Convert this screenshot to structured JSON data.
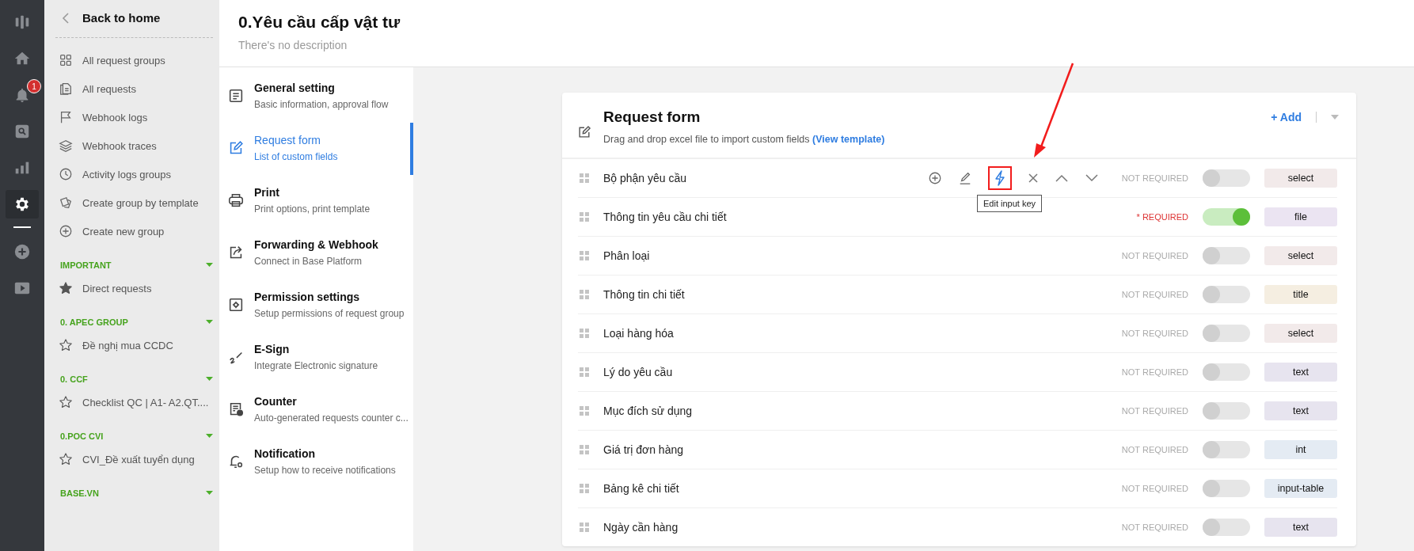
{
  "rail": [
    {
      "selected": false
    },
    {
      "selected": false
    },
    {
      "selected": false,
      "badge": "1"
    },
    {
      "selected": false
    },
    {
      "selected": false
    },
    {
      "selected": true
    },
    {
      "selected": false
    },
    {
      "selected": false
    }
  ],
  "sidebar": {
    "back": "Back to home",
    "items": [
      "All request groups",
      "All requests",
      "Webhook logs",
      "Webhook traces",
      "Activity logs groups",
      "Create group by template",
      "Create new group"
    ],
    "groups": [
      {
        "title": "IMPORTANT",
        "items": [
          {
            "label": "Direct requests",
            "starred": true
          }
        ]
      },
      {
        "title": "0. APEC GROUP",
        "items": [
          {
            "label": "Đề nghị mua CCDC",
            "starred": false
          }
        ]
      },
      {
        "title": "0. CCF",
        "items": [
          {
            "label": "Checklist QC | A1- A2.QT....",
            "starred": false
          }
        ]
      },
      {
        "title": "0.POC CVI",
        "items": [
          {
            "label": "CVI_Đề xuất tuyển dụng",
            "starred": false
          }
        ]
      },
      {
        "title": "BASE.VN"
      }
    ]
  },
  "page": {
    "title": "0.Yêu cầu cấp vật tư",
    "description": "There's no description"
  },
  "menu": [
    {
      "title": "General setting",
      "subtitle": "Basic information, approval flow",
      "selected": false
    },
    {
      "title": "Request form",
      "subtitle": "List of custom fields",
      "selected": true
    },
    {
      "title": "Print",
      "subtitle": "Print options, print template",
      "selected": false
    },
    {
      "title": "Forwarding & Webhook",
      "subtitle": "Connect in Base Platform",
      "selected": false
    },
    {
      "title": "Permission settings",
      "subtitle": "Setup permissions of request group",
      "selected": false
    },
    {
      "title": "E-Sign",
      "subtitle": "Integrate Electronic signature",
      "selected": false
    },
    {
      "title": "Counter",
      "subtitle": "Auto-generated requests counter c...",
      "selected": false
    },
    {
      "title": "Notification",
      "subtitle": "Setup how to receive notifications",
      "selected": false
    }
  ],
  "form": {
    "title": "Request form",
    "hint": "Drag and drop excel file to import custom fields **(View template)**",
    "add": "+ Add",
    "fields": [
      {
        "label": "Bộ phận yêu cầu",
        "hovered": true,
        "tooltip": "Edit input key",
        "requirement": "NOT REQUIRED",
        "required": false,
        "type": "select",
        "color": "#f2eaea"
      },
      {
        "label": "Thông tin yêu cầu chi tiết",
        "hovered": false,
        "requirement": "* REQUIRED",
        "required": true,
        "type": "file",
        "color": "#ebe4f2"
      },
      {
        "label": "Phân loại",
        "hovered": false,
        "requirement": "NOT REQUIRED",
        "required": false,
        "type": "select",
        "color": "#f2eaea"
      },
      {
        "label": "Thông tin chi tiết",
        "hovered": false,
        "requirement": "NOT REQUIRED",
        "required": false,
        "type": "title",
        "color": "#f5eee1"
      },
      {
        "label": "Loại hàng hóa",
        "hovered": false,
        "requirement": "NOT REQUIRED",
        "required": false,
        "type": "select",
        "color": "#f2eaea"
      },
      {
        "label": "Lý do yêu cầu",
        "hovered": false,
        "requirement": "NOT REQUIRED",
        "required": false,
        "type": "text",
        "color": "#e7e4ef"
      },
      {
        "label": "Mục đích sử dụng",
        "hovered": false,
        "requirement": "NOT REQUIRED",
        "required": false,
        "type": "text",
        "color": "#e7e4ef"
      },
      {
        "label": "Giá trị đơn hàng",
        "hovered": false,
        "requirement": "NOT REQUIRED",
        "required": false,
        "type": "int",
        "color": "#e4ebf3"
      },
      {
        "label": "Bảng kê chi tiết",
        "hovered": false,
        "requirement": "NOT REQUIRED",
        "required": false,
        "type": "input-table",
        "color": "#e4ebf3"
      },
      {
        "label": "Ngày cần hàng",
        "hovered": false,
        "requirement": "NOT REQUIRED",
        "required": false,
        "type": "text",
        "color": "#e7e4ef"
      }
    ]
  }
}
